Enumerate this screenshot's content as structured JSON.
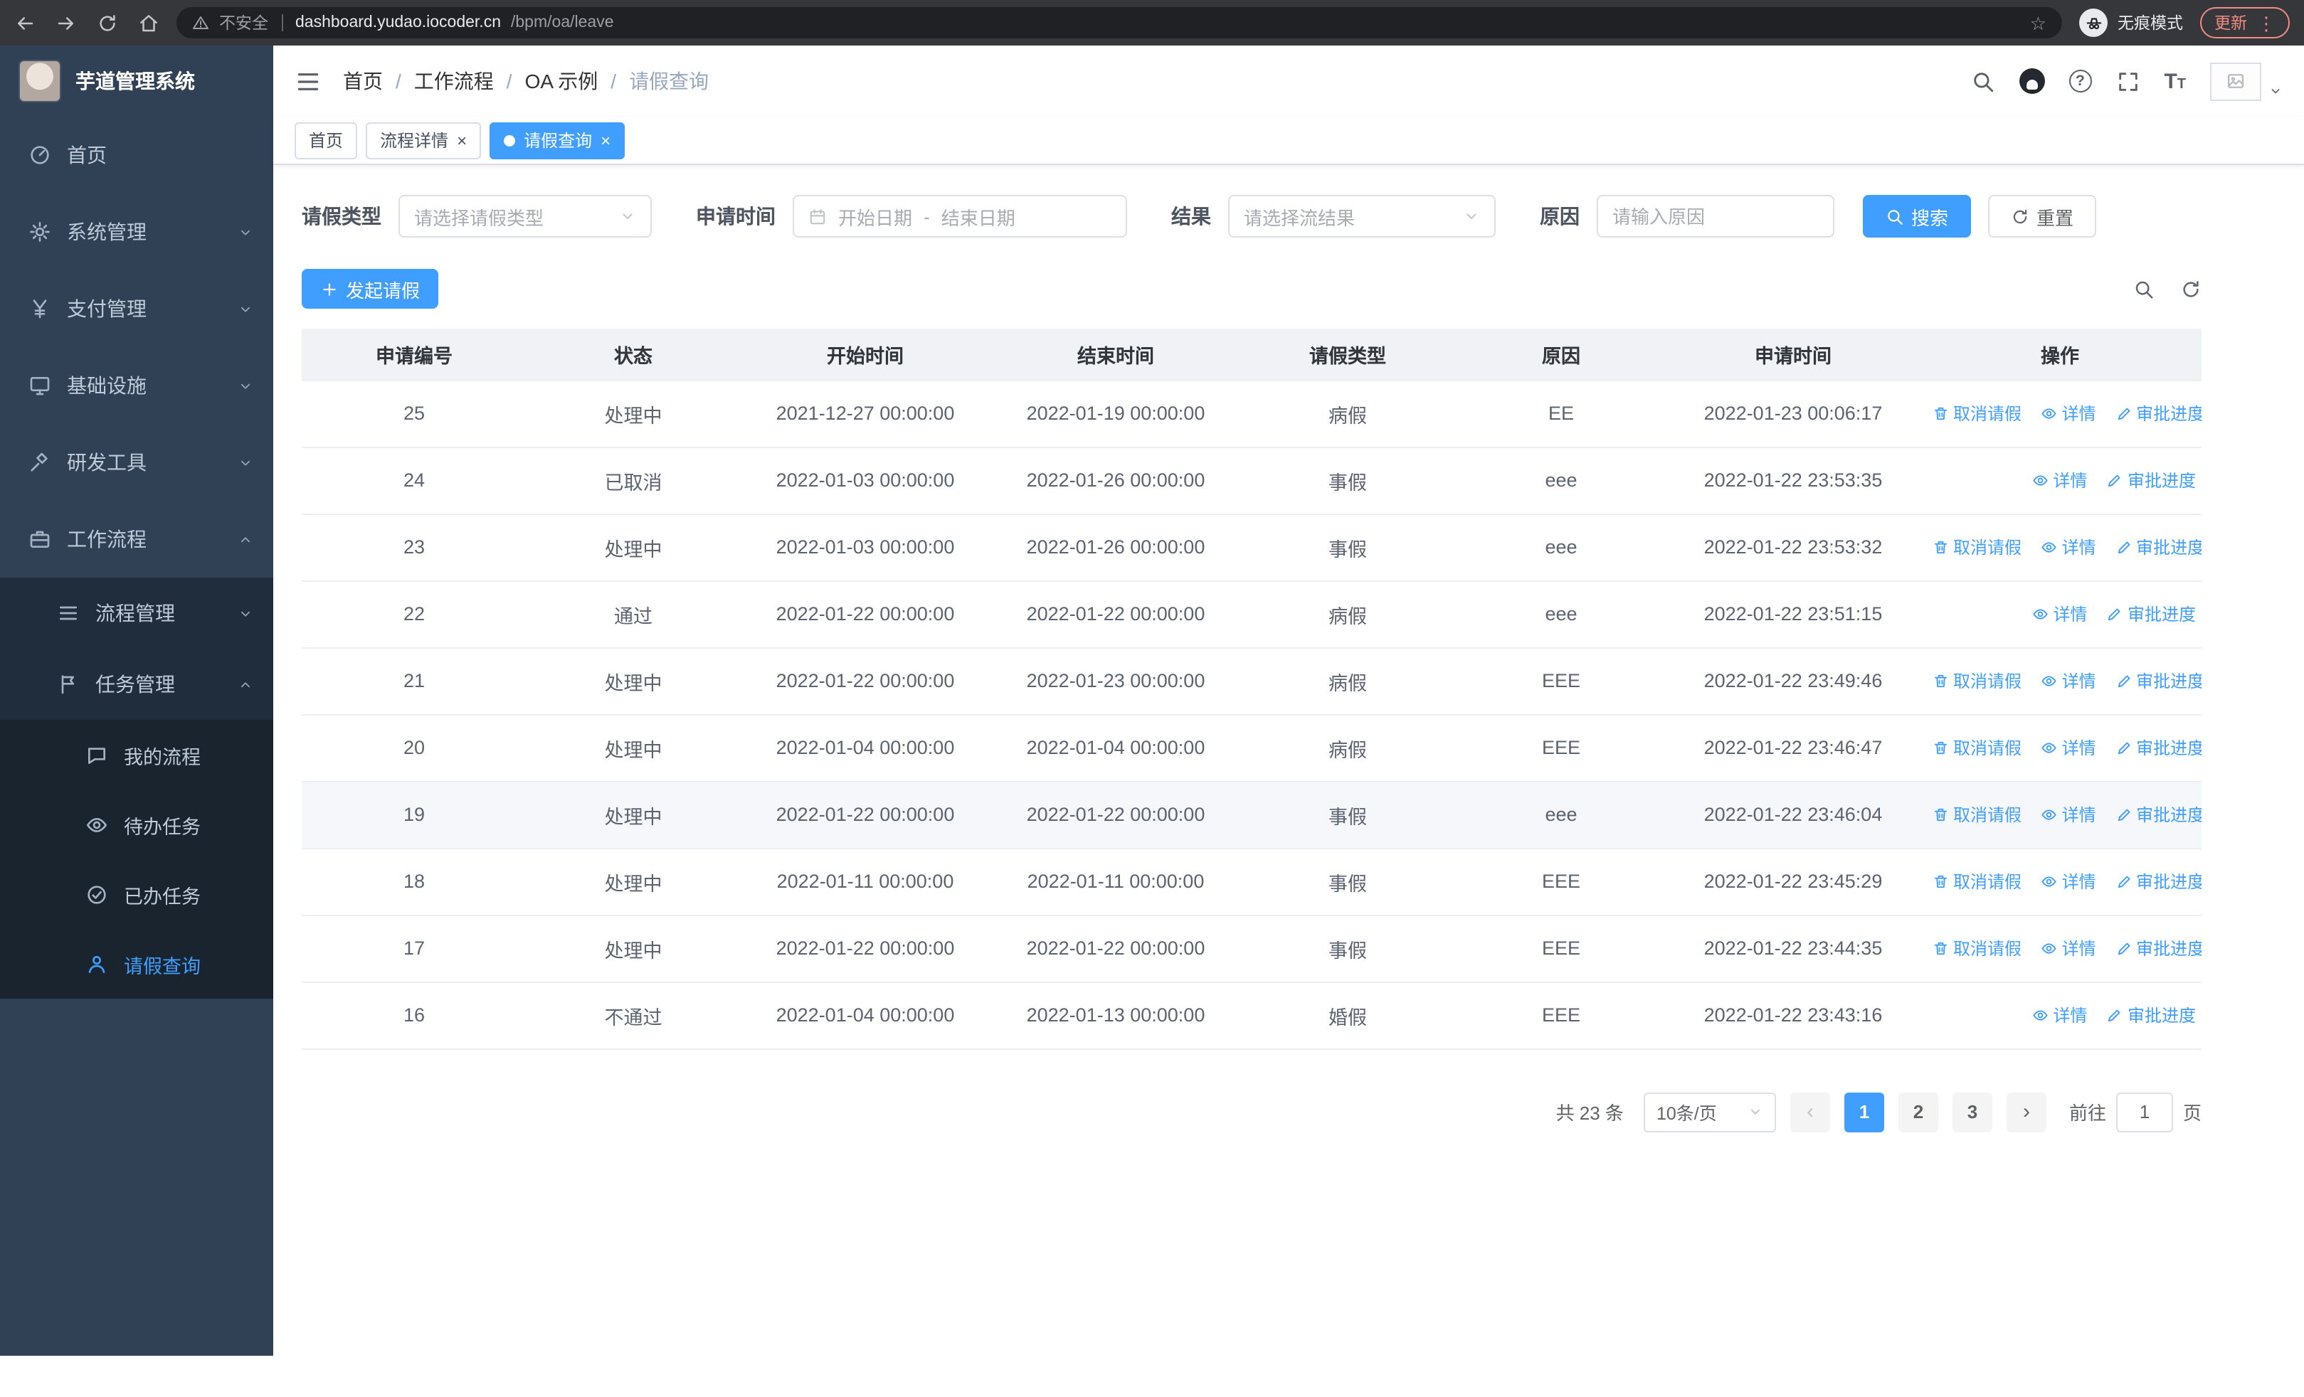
{
  "browser": {
    "security_label": "不安全",
    "url_host": "dashboard.yudao.iocoder.cn",
    "url_path": "/bpm/oa/leave",
    "incognito_label": "无痕模式",
    "update_label": "更新"
  },
  "sidebar": {
    "title": "芋道管理系统",
    "items": {
      "home": "首页",
      "system": "系统管理",
      "payment": "支付管理",
      "infra": "基础设施",
      "devtools": "研发工具",
      "workflow": "工作流程",
      "process_mgmt": "流程管理",
      "task_mgmt": "任务管理",
      "my_process": "我的流程",
      "todo_tasks": "待办任务",
      "done_tasks": "已办任务",
      "leave_query": "请假查询"
    }
  },
  "navbar": {
    "breadcrumb": [
      "首页",
      "工作流程",
      "OA 示例",
      "请假查询"
    ],
    "separator": "/"
  },
  "tabs": [
    {
      "label": "首页"
    },
    {
      "label": "流程详情"
    },
    {
      "label": "请假查询"
    }
  ],
  "filters": {
    "leave_type_label": "请假类型",
    "leave_type_placeholder": "请选择请假类型",
    "apply_time_label": "申请时间",
    "date_start_placeholder": "开始日期",
    "date_separator": "-",
    "date_end_placeholder": "结束日期",
    "result_label": "结果",
    "result_placeholder": "请选择流结果",
    "reason_label": "原因",
    "reason_placeholder": "请输入原因",
    "search_label": "搜索",
    "reset_label": "重置"
  },
  "toolbar": {
    "create_label": "发起请假"
  },
  "table": {
    "columns": [
      "申请编号",
      "状态",
      "开始时间",
      "结束时间",
      "请假类型",
      "原因",
      "申请时间",
      "操作"
    ],
    "action_labels": {
      "cancel": "取消请假",
      "detail": "详情",
      "progress": "审批进度"
    },
    "rows": [
      {
        "id": "25",
        "status": "处理中",
        "start": "2021-12-27 00:00:00",
        "end": "2022-01-19 00:00:00",
        "type": "病假",
        "reason": "EE",
        "applied": "2022-01-23 00:06:17",
        "can_cancel": true,
        "highlight": false
      },
      {
        "id": "24",
        "status": "已取消",
        "start": "2022-01-03 00:00:00",
        "end": "2022-01-26 00:00:00",
        "type": "事假",
        "reason": "eee",
        "applied": "2022-01-22 23:53:35",
        "can_cancel": false,
        "highlight": false
      },
      {
        "id": "23",
        "status": "处理中",
        "start": "2022-01-03 00:00:00",
        "end": "2022-01-26 00:00:00",
        "type": "事假",
        "reason": "eee",
        "applied": "2022-01-22 23:53:32",
        "can_cancel": true,
        "highlight": false
      },
      {
        "id": "22",
        "status": "通过",
        "start": "2022-01-22 00:00:00",
        "end": "2022-01-22 00:00:00",
        "type": "病假",
        "reason": "eee",
        "applied": "2022-01-22 23:51:15",
        "can_cancel": false,
        "highlight": false
      },
      {
        "id": "21",
        "status": "处理中",
        "start": "2022-01-22 00:00:00",
        "end": "2022-01-23 00:00:00",
        "type": "病假",
        "reason": "EEE",
        "applied": "2022-01-22 23:49:46",
        "can_cancel": true,
        "highlight": false
      },
      {
        "id": "20",
        "status": "处理中",
        "start": "2022-01-04 00:00:00",
        "end": "2022-01-04 00:00:00",
        "type": "病假",
        "reason": "EEE",
        "applied": "2022-01-22 23:46:47",
        "can_cancel": true,
        "highlight": false
      },
      {
        "id": "19",
        "status": "处理中",
        "start": "2022-01-22 00:00:00",
        "end": "2022-01-22 00:00:00",
        "type": "事假",
        "reason": "eee",
        "applied": "2022-01-22 23:46:04",
        "can_cancel": true,
        "highlight": true
      },
      {
        "id": "18",
        "status": "处理中",
        "start": "2022-01-11 00:00:00",
        "end": "2022-01-11 00:00:00",
        "type": "事假",
        "reason": "EEE",
        "applied": "2022-01-22 23:45:29",
        "can_cancel": true,
        "highlight": false
      },
      {
        "id": "17",
        "status": "处理中",
        "start": "2022-01-22 00:00:00",
        "end": "2022-01-22 00:00:00",
        "type": "事假",
        "reason": "EEE",
        "applied": "2022-01-22 23:44:35",
        "can_cancel": true,
        "highlight": false
      },
      {
        "id": "16",
        "status": "不通过",
        "start": "2022-01-04 00:00:00",
        "end": "2022-01-13 00:00:00",
        "type": "婚假",
        "reason": "EEE",
        "applied": "2022-01-22 23:43:16",
        "can_cancel": false,
        "highlight": false
      }
    ]
  },
  "pagination": {
    "total_label": "共 23 条",
    "page_size_label": "10条/页",
    "pages": [
      "1",
      "2",
      "3"
    ],
    "goto_label": "前往",
    "goto_value": "1",
    "goto_suffix": "页"
  },
  "colors": {
    "primary": "#409eff",
    "sidebar_bg": "#304156",
    "submenu_bg": "#1f2d3d",
    "table_header_bg": "#f0f2f5",
    "update_badge": "#f28b82"
  }
}
